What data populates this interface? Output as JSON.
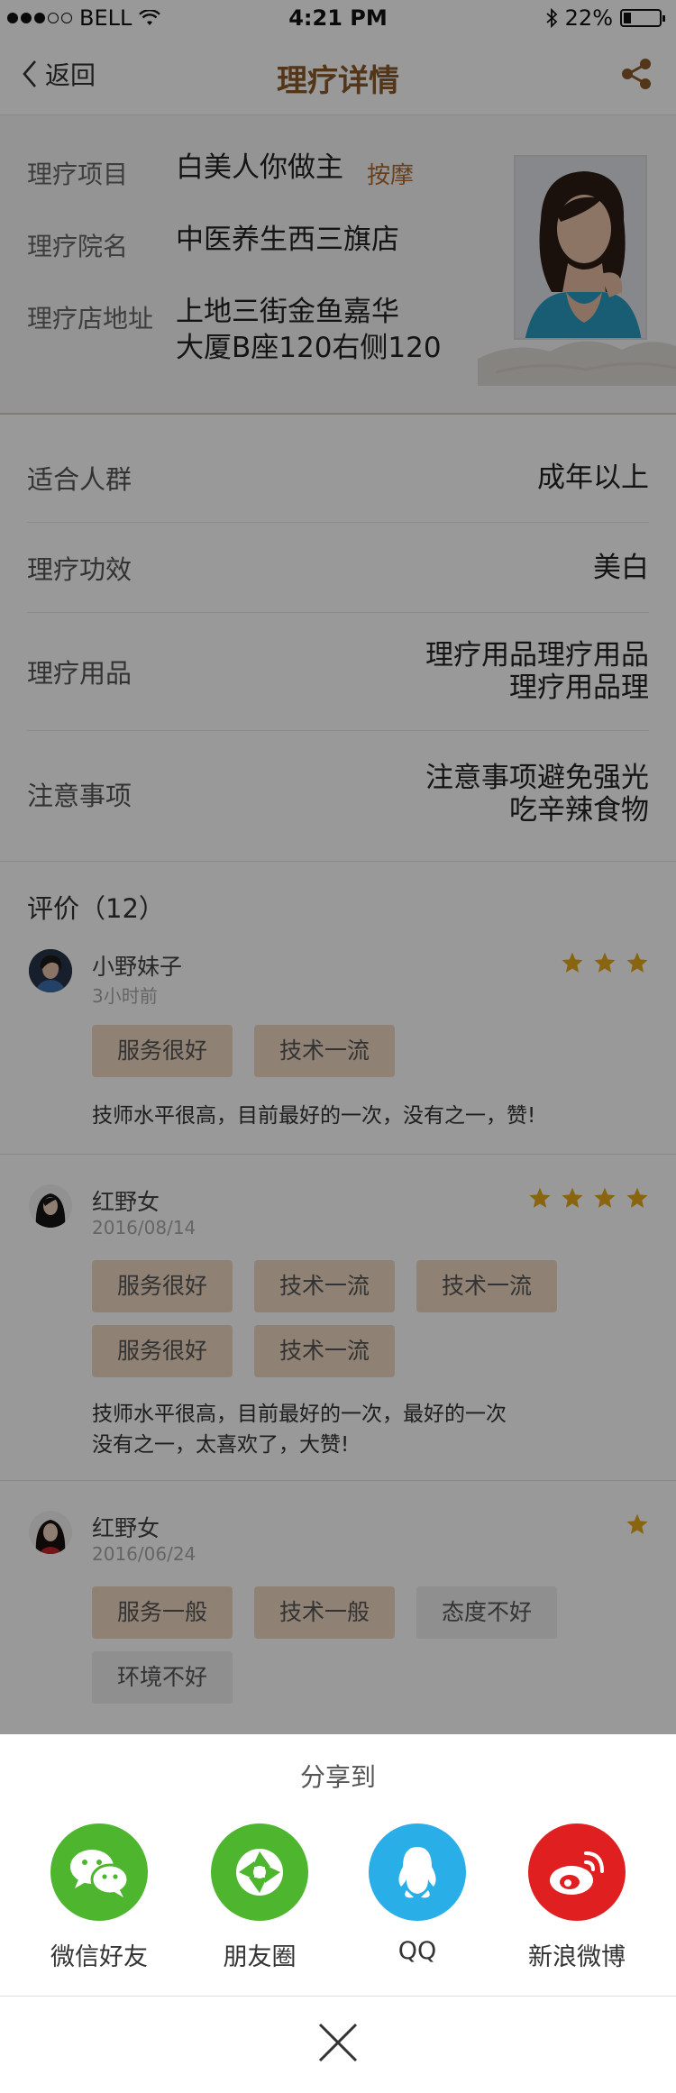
{
  "status_bar": {
    "carrier": "BELL",
    "time": "4:21 PM",
    "battery": "22%",
    "battery_level": 0.22
  },
  "nav": {
    "back_label": "返回",
    "title": "理疗详情"
  },
  "info": {
    "project_label": "理疗项目",
    "project_value": "白美人你做主",
    "project_tag": "按摩",
    "clinic_label": "理疗院名",
    "clinic_value": "中医养生西三旗店",
    "address_label": "理疗店地址",
    "address_line1": "上地三街金鱼嘉华",
    "address_line2": "大厦B座120右侧120"
  },
  "attributes": [
    {
      "key": "适合人群",
      "lines": [
        "成年以上"
      ]
    },
    {
      "key": "理疗功效",
      "lines": [
        "美白"
      ]
    },
    {
      "key": "理疗用品",
      "lines": [
        "理疗用品理疗用品",
        "理疗用品理"
      ]
    },
    {
      "key": "注意事项",
      "lines": [
        "注意事项避免强光",
        "吃辛辣食物"
      ]
    }
  ],
  "reviews_header": "评价（12）",
  "reviews": [
    {
      "name": "小野妹子",
      "date": "3小时前",
      "rating": 3,
      "tags": [
        {
          "label": "服务很好",
          "positive": true
        },
        {
          "label": "技术一流",
          "positive": true
        }
      ],
      "comment_lines": [
        "技师水平很高，目前最好的一次，没有之一，赞!"
      ]
    },
    {
      "name": "红野女",
      "date": "2016/08/14",
      "rating": 4,
      "tags": [
        {
          "label": "服务很好",
          "positive": true
        },
        {
          "label": "技术一流",
          "positive": true
        },
        {
          "label": "技术一流",
          "positive": true
        },
        {
          "label": "服务很好",
          "positive": true
        },
        {
          "label": "技术一流",
          "positive": true
        }
      ],
      "comment_lines": [
        "技师水平很高，目前最好的一次，最好的一次",
        "没有之一，太喜欢了，大赞!"
      ]
    },
    {
      "name": "红野女",
      "date": "2016/06/24",
      "rating": 1,
      "tags": [
        {
          "label": "服务一般",
          "positive": true
        },
        {
          "label": "技术一般",
          "positive": true
        },
        {
          "label": "态度不好",
          "positive": false
        },
        {
          "label": "环境不好",
          "positive": false
        }
      ],
      "comment_lines": []
    }
  ],
  "share": {
    "title": "分享到",
    "items": [
      {
        "label": "微信好友",
        "icon": "wechat-icon",
        "color": "#4eb52e"
      },
      {
        "label": "朋友圈",
        "icon": "moments-icon",
        "color": "#4eb52e"
      },
      {
        "label": "QQ",
        "icon": "qq-icon",
        "color": "#2aaee8"
      },
      {
        "label": "新浪微博",
        "icon": "weibo-icon",
        "color": "#e02020"
      }
    ]
  },
  "colors": {
    "accent": "#8a5a2b",
    "tag": "#b26a2a",
    "star": "#e5a91b",
    "chip_positive": "#eed9c4",
    "chip_negative": "#eeeeee"
  }
}
